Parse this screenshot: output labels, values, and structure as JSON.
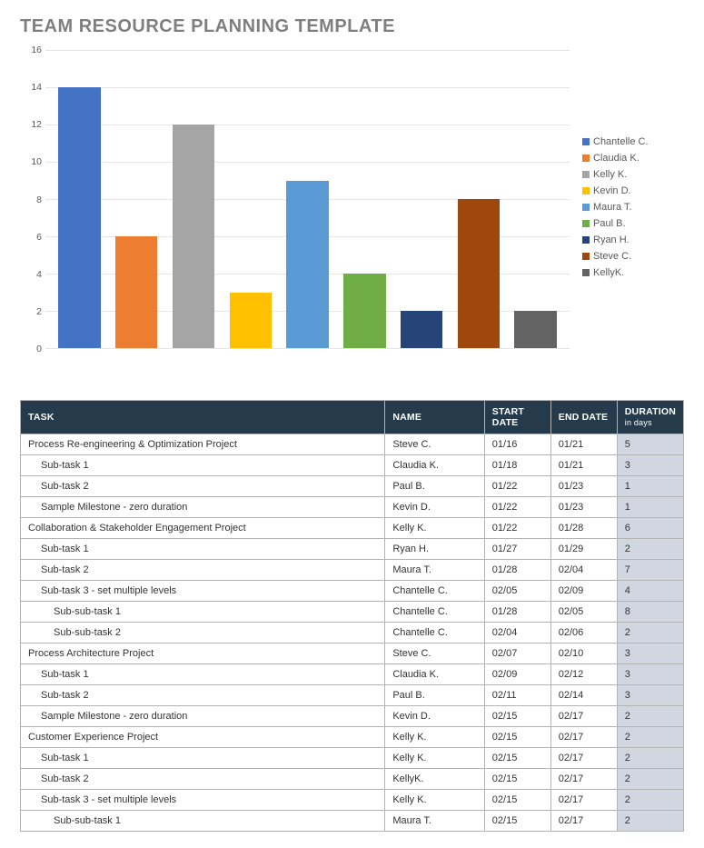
{
  "title": "TEAM RESOURCE PLANNING TEMPLATE",
  "chart_data": {
    "type": "bar",
    "title": "",
    "xlabel": "",
    "ylabel": "",
    "ylim": [
      0,
      16
    ],
    "yticks": [
      0,
      2,
      4,
      6,
      8,
      10,
      12,
      14,
      16
    ],
    "series": [
      {
        "name": "Chantelle C.",
        "value": 14,
        "color": "#4472c4"
      },
      {
        "name": "Claudia K.",
        "value": 6,
        "color": "#ed7d31"
      },
      {
        "name": "Kelly K.",
        "value": 12,
        "color": "#a5a5a5"
      },
      {
        "name": "Kevin D.",
        "value": 3,
        "color": "#ffc000"
      },
      {
        "name": "Maura T.",
        "value": 9,
        "color": "#5b9bd5"
      },
      {
        "name": "Paul B.",
        "value": 4,
        "color": "#70ad47"
      },
      {
        "name": "Ryan H.",
        "value": 2,
        "color": "#264478"
      },
      {
        "name": "Steve C.",
        "value": 8,
        "color": "#9e480e"
      },
      {
        "name": "KellyK.",
        "value": 2,
        "color": "#636363"
      }
    ]
  },
  "table": {
    "headers": {
      "task": "TASK",
      "name": "NAME",
      "start": "START DATE",
      "end": "END DATE",
      "duration": "DURATION",
      "duration_unit": "in days"
    },
    "rows": [
      {
        "task": "Process Re-engineering & Optimization Project",
        "indent": 0,
        "name": "Steve C.",
        "start": "01/16",
        "end": "01/21",
        "duration": "5"
      },
      {
        "task": "Sub-task 1",
        "indent": 1,
        "name": "Claudia K.",
        "start": "01/18",
        "end": "01/21",
        "duration": "3"
      },
      {
        "task": "Sub-task 2",
        "indent": 1,
        "name": "Paul B.",
        "start": "01/22",
        "end": "01/23",
        "duration": "1"
      },
      {
        "task": "Sample Milestone - zero duration",
        "indent": 1,
        "name": "Kevin D.",
        "start": "01/22",
        "end": "01/23",
        "duration": "1"
      },
      {
        "task": "Collaboration & Stakeholder Engagement Project",
        "indent": 0,
        "name": "Kelly K.",
        "start": "01/22",
        "end": "01/28",
        "duration": "6"
      },
      {
        "task": "Sub-task 1",
        "indent": 1,
        "name": "Ryan H.",
        "start": "01/27",
        "end": "01/29",
        "duration": "2"
      },
      {
        "task": "Sub-task 2",
        "indent": 1,
        "name": "Maura T.",
        "start": "01/28",
        "end": "02/04",
        "duration": "7"
      },
      {
        "task": "Sub-task 3 - set multiple levels",
        "indent": 1,
        "name": "Chantelle C.",
        "start": "02/05",
        "end": "02/09",
        "duration": "4"
      },
      {
        "task": "Sub-sub-task 1",
        "indent": 2,
        "name": "Chantelle C.",
        "start": "01/28",
        "end": "02/05",
        "duration": "8"
      },
      {
        "task": "Sub-sub-task 2",
        "indent": 2,
        "name": "Chantelle C.",
        "start": "02/04",
        "end": "02/06",
        "duration": "2"
      },
      {
        "task": "Process Architecture Project",
        "indent": 0,
        "name": "Steve C.",
        "start": "02/07",
        "end": "02/10",
        "duration": "3"
      },
      {
        "task": "Sub-task 1",
        "indent": 1,
        "name": "Claudia K.",
        "start": "02/09",
        "end": "02/12",
        "duration": "3"
      },
      {
        "task": "Sub-task 2",
        "indent": 1,
        "name": "Paul B.",
        "start": "02/11",
        "end": "02/14",
        "duration": "3"
      },
      {
        "task": "Sample Milestone - zero duration",
        "indent": 1,
        "name": "Kevin D.",
        "start": "02/15",
        "end": "02/17",
        "duration": "2"
      },
      {
        "task": "Customer Experience Project",
        "indent": 0,
        "name": "Kelly K.",
        "start": "02/15",
        "end": "02/17",
        "duration": "2"
      },
      {
        "task": "Sub-task 1",
        "indent": 1,
        "name": "Kelly K.",
        "start": "02/15",
        "end": "02/17",
        "duration": "2"
      },
      {
        "task": "Sub-task 2",
        "indent": 1,
        "name": "KellyK.",
        "start": "02/15",
        "end": "02/17",
        "duration": "2"
      },
      {
        "task": "Sub-task 3 - set multiple levels",
        "indent": 1,
        "name": "Kelly K.",
        "start": "02/15",
        "end": "02/17",
        "duration": "2"
      },
      {
        "task": "Sub-sub-task 1",
        "indent": 2,
        "name": "Maura T.",
        "start": "02/15",
        "end": "02/17",
        "duration": "2"
      }
    ]
  }
}
